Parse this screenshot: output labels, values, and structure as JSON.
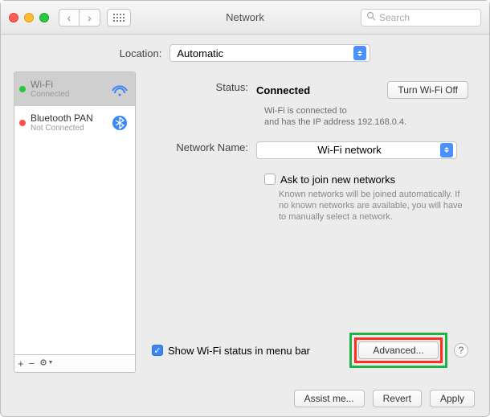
{
  "window": {
    "title": "Network",
    "search_placeholder": "Search"
  },
  "location": {
    "label": "Location:",
    "value": "Automatic"
  },
  "services": [
    {
      "name": "Wi-Fi",
      "status": "Connected",
      "selected": true,
      "dot": "grn"
    },
    {
      "name": "Bluetooth PAN",
      "status": "Not Connected",
      "selected": false,
      "dot": "rd"
    }
  ],
  "sidebar_toolbar": {
    "add": "+",
    "remove": "−",
    "gear": "✻▾"
  },
  "detail": {
    "status_label": "Status:",
    "status_value": "Connected",
    "wifi_off_btn": "Turn Wi-Fi Off",
    "substatus": "Wi-Fi is connected to\n        and has the IP address 192.168.0.4.",
    "netname_label": "Network Name:",
    "netname_value": "Wi-Fi network",
    "ask_join": "Ask to join new networks",
    "ask_note": "Known networks will be joined automatically. If no known networks are available, you will have to manually select a network.",
    "show_status": "Show Wi-Fi status in menu bar",
    "advanced": "Advanced...",
    "help": "?"
  },
  "footer": {
    "assist": "Assist me...",
    "revert": "Revert",
    "apply": "Apply"
  }
}
